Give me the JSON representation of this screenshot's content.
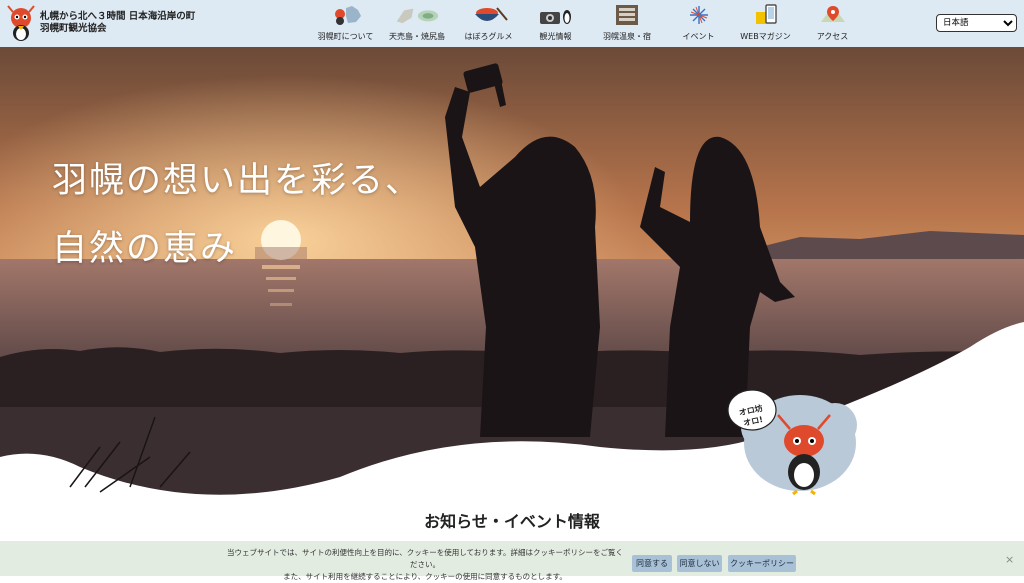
{
  "brand": {
    "line1": "札幌から北へ３時間 日本海沿岸の町",
    "line2": "羽幌町観光協会"
  },
  "nav": {
    "items": [
      {
        "label": "羽幌町について",
        "icon": "town-map-icon"
      },
      {
        "label": "天売島・焼尻島",
        "icon": "islands-icon"
      },
      {
        "label": "はぼろグルメ",
        "icon": "gourmet-bowl-icon"
      },
      {
        "label": "観光情報",
        "icon": "camera-icon"
      },
      {
        "label": "羽幌温泉・宿",
        "icon": "hotel-icon"
      },
      {
        "label": "イベント",
        "icon": "fireworks-icon"
      },
      {
        "label": "WEBマガジン",
        "icon": "magazine-icon"
      },
      {
        "label": "アクセス",
        "icon": "map-pin-icon"
      }
    ]
  },
  "language": {
    "selected": "日本語"
  },
  "hero": {
    "line1": "羽幌の想い出を彩る、",
    "line2": "自然の恵み",
    "mascot_bubble_1": "オロ坊",
    "mascot_bubble_2": "オロ!"
  },
  "section": {
    "title": "お知らせ・イベント情報"
  },
  "cookie": {
    "line1": "当ウェブサイトでは、サイトの利便性向上を目的に、クッキーを使用しております。詳細はクッキーポリシーをご覧ください。",
    "line2": "また、サイト利用を継続することにより、クッキーの使用に同意するものとします。",
    "accept": "同意する",
    "decline": "同意しない",
    "policy": "クッキーポリシー",
    "close": "×"
  },
  "colors": {
    "header_bg": "#dde9f3",
    "cookie_bg": "#e3ece1",
    "cookie_btn": "#a9c1d6"
  }
}
